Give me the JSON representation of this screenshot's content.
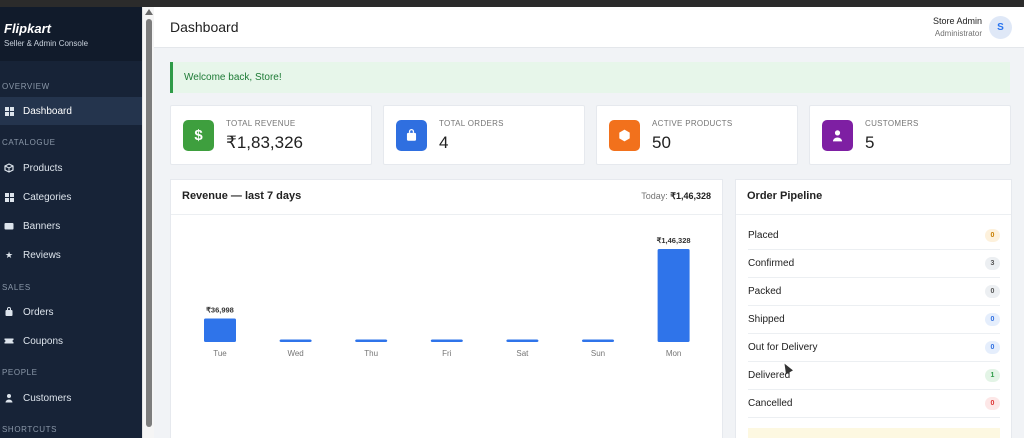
{
  "brand": {
    "name": "Flipkart",
    "subtitle": "Seller & Admin Console"
  },
  "sidebar": {
    "sections": [
      "OVERVIEW",
      "CATALOGUE",
      "SALES",
      "PEOPLE",
      "SHORTCUTS"
    ],
    "items": [
      {
        "label": "Dashboard",
        "icon": "dashboard-icon"
      },
      {
        "label": "Products",
        "icon": "box-icon"
      },
      {
        "label": "Categories",
        "icon": "grid-icon"
      },
      {
        "label": "Banners",
        "icon": "image-icon"
      },
      {
        "label": "Reviews",
        "icon": "star-icon"
      },
      {
        "label": "Orders",
        "icon": "bag-icon"
      },
      {
        "label": "Coupons",
        "icon": "ticket-icon"
      },
      {
        "label": "Customers",
        "icon": "person-icon"
      }
    ]
  },
  "header": {
    "title": "Dashboard",
    "user_name": "Store Admin",
    "user_role": "Administrator",
    "avatar_initial": "S"
  },
  "welcome": "Welcome back, Store!",
  "stats": [
    {
      "label": "TOTAL REVENUE",
      "value": "₹1,83,326",
      "icon": "rupee-icon",
      "color": "#3e9f3e"
    },
    {
      "label": "TOTAL ORDERS",
      "value": "4",
      "icon": "bag-icon",
      "color": "#2f6fe0"
    },
    {
      "label": "ACTIVE PRODUCTS",
      "value": "50",
      "icon": "cube-icon",
      "color": "#f2711c"
    },
    {
      "label": "CUSTOMERS",
      "value": "5",
      "icon": "person-icon",
      "color": "#7e1fa3"
    }
  ],
  "revenue": {
    "title": "Revenue — last 7 days",
    "today_label": "Today:",
    "today_value": "₹1,46,328"
  },
  "chart_data": {
    "type": "bar",
    "categories": [
      "Tue",
      "Wed",
      "Thu",
      "Fri",
      "Sat",
      "Sun",
      "Mon"
    ],
    "values": [
      36998,
      0,
      0,
      0,
      0,
      0,
      146328
    ],
    "data_labels": [
      "₹36,998",
      "",
      "",
      "",
      "",
      "",
      "₹1,46,328"
    ],
    "color": "#2f74ea"
  },
  "pipeline": {
    "title": "Order Pipeline",
    "rows": [
      {
        "label": "Placed",
        "count": "0",
        "bg": "#fdf1dc",
        "fg": "#c77d00"
      },
      {
        "label": "Confirmed",
        "count": "3",
        "bg": "#eceff2",
        "fg": "#555"
      },
      {
        "label": "Packed",
        "count": "0",
        "bg": "#eceff2",
        "fg": "#555"
      },
      {
        "label": "Shipped",
        "count": "0",
        "bg": "#e5eefc",
        "fg": "#2f6fe0"
      },
      {
        "label": "Out for Delivery",
        "count": "0",
        "bg": "#e5eefc",
        "fg": "#2f6fe0"
      },
      {
        "label": "Delivered",
        "count": "1",
        "bg": "#e3f4e6",
        "fg": "#2e9b47"
      },
      {
        "label": "Cancelled",
        "count": "0",
        "bg": "#fde7e7",
        "fg": "#d33"
      }
    ]
  }
}
